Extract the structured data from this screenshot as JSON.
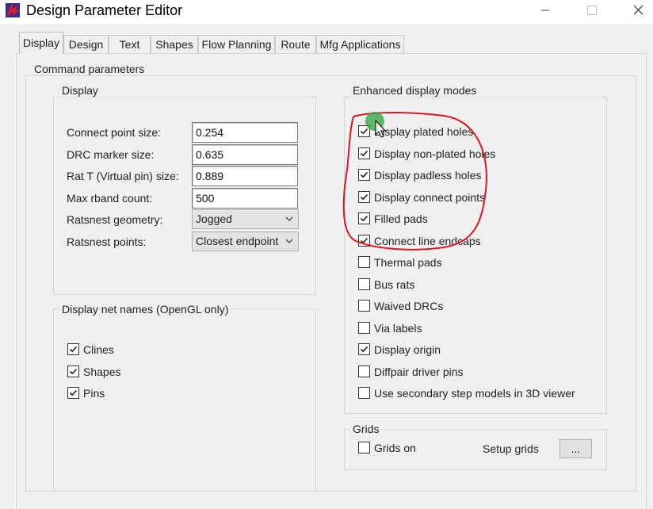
{
  "window": {
    "title": "Design Parameter Editor",
    "minimize_icon": "minimize-icon",
    "maximize_icon": "maximize-icon",
    "close_icon": "close-icon"
  },
  "tabs": [
    {
      "label": "Display",
      "active": true
    },
    {
      "label": "Design"
    },
    {
      "label": "Text"
    },
    {
      "label": "Shapes"
    },
    {
      "label": "Flow Planning"
    },
    {
      "label": "Route"
    },
    {
      "label": "Mfg Applications"
    }
  ],
  "command_parameters": {
    "label": "Command parameters",
    "display": {
      "label": "Display",
      "fields": [
        {
          "label": "Connect point size:",
          "value": "0.254"
        },
        {
          "label": "DRC marker size:",
          "value": "0.635"
        },
        {
          "label": "Rat T (Virtual pin) size:",
          "value": "0.889"
        },
        {
          "label": "Max rband count:",
          "value": "500"
        }
      ],
      "selects": [
        {
          "label": "Ratsnest geometry:",
          "value": "Jogged"
        },
        {
          "label": "Ratsnest points:",
          "value": "Closest endpoint"
        }
      ]
    },
    "net_names": {
      "label": "Display net names (OpenGL only)",
      "items": [
        {
          "label": "Clines",
          "checked": true
        },
        {
          "label": "Shapes",
          "checked": true
        },
        {
          "label": "Pins",
          "checked": true
        }
      ]
    },
    "enhanced": {
      "label": "Enhanced display modes",
      "items": [
        {
          "label": "Display plated holes",
          "checked": true
        },
        {
          "label": "Display non-plated holes",
          "checked": true
        },
        {
          "label": "Display padless holes",
          "checked": true
        },
        {
          "label": "Display connect points",
          "checked": true
        },
        {
          "label": "Filled pads",
          "checked": true
        },
        {
          "label": "Connect line endcaps",
          "checked": true
        },
        {
          "label": "Thermal pads",
          "checked": false
        },
        {
          "label": "Bus rats",
          "checked": false
        },
        {
          "label": "Waived DRCs",
          "checked": false
        },
        {
          "label": "Via labels",
          "checked": false
        },
        {
          "label": "Display origin",
          "checked": true
        },
        {
          "label": "Diffpair driver pins",
          "checked": false
        },
        {
          "label": "Use secondary step models in 3D viewer",
          "checked": false
        }
      ]
    },
    "grids": {
      "label": "Grids",
      "grids_on": {
        "label": "Grids on",
        "checked": false
      },
      "setup_label": "Setup grids",
      "setup_button": "..."
    }
  },
  "annotation": {
    "color": "#e0141e",
    "cursor_marker_color": "#3aa84a"
  }
}
